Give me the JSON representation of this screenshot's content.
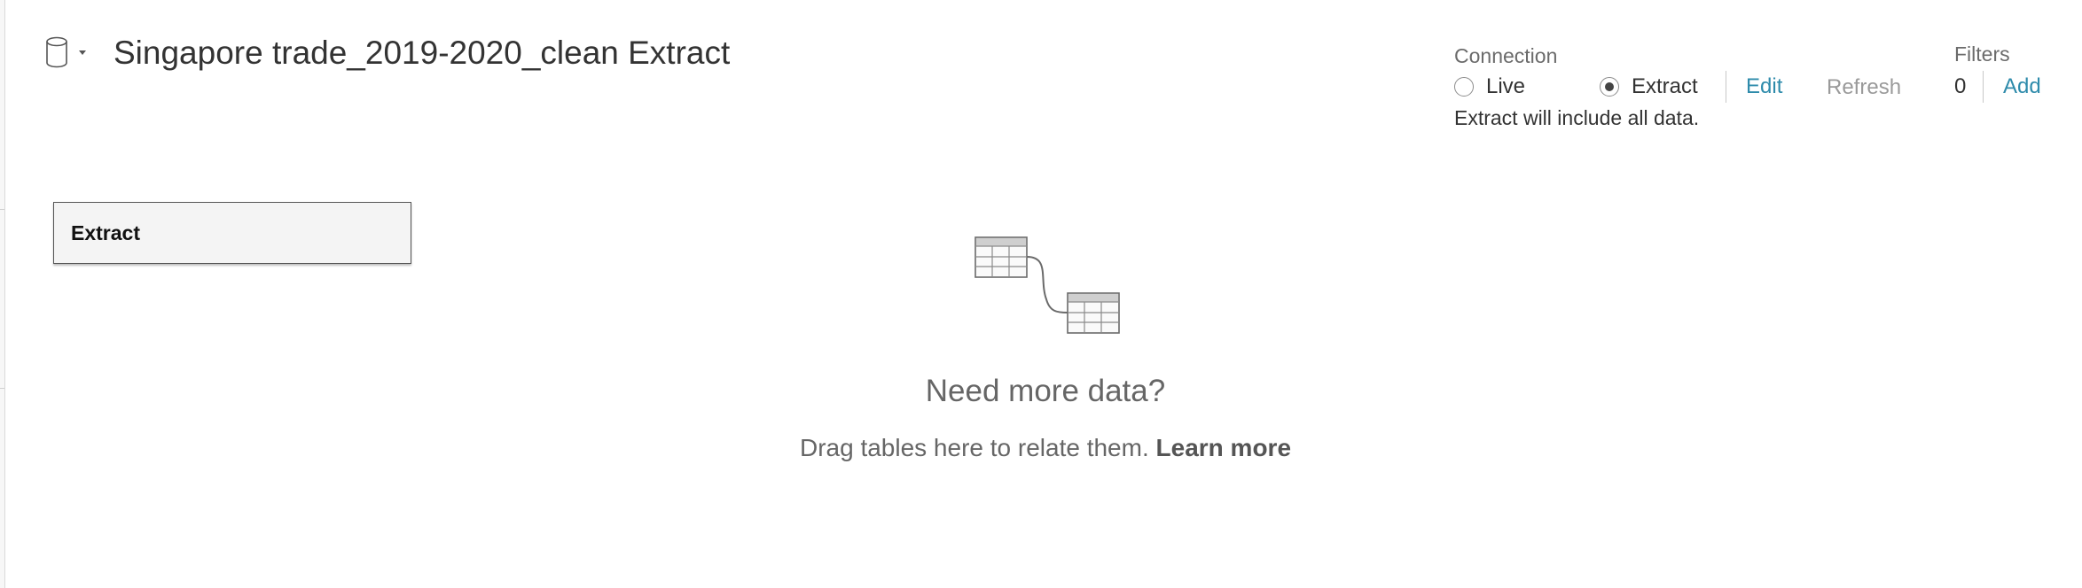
{
  "header": {
    "title": "Singapore trade_2019-2020_clean Extract",
    "datasource_icon": "database-icon"
  },
  "connection": {
    "label": "Connection",
    "options": [
      {
        "label": "Live",
        "selected": false
      },
      {
        "label": "Extract",
        "selected": true
      }
    ],
    "edit_label": "Edit",
    "refresh_label": "Refresh",
    "extract_note": "Extract will include all data."
  },
  "filters": {
    "label": "Filters",
    "count": "0",
    "add_label": "Add"
  },
  "canvas": {
    "table_name": "Extract",
    "empty_title": "Need more data?",
    "empty_hint": "Drag tables here to relate them.",
    "learn_more": "Learn more",
    "illustration_icon": "related-tables-icon"
  },
  "colors": {
    "link": "#2e8bab",
    "muted": "#9a9a9a",
    "text": "#333333"
  }
}
